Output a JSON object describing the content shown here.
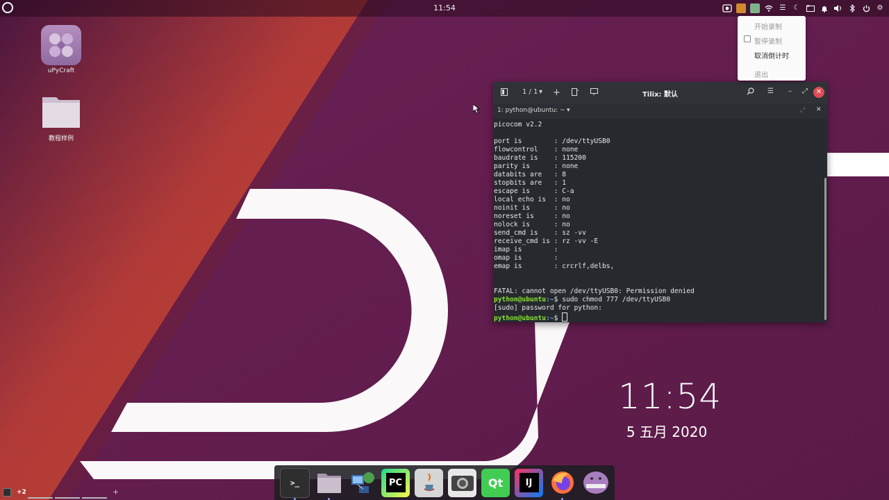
{
  "topbar": {
    "clock": "11:54",
    "tray": [
      "screen-record-icon",
      "app-icon-orange",
      "app-icon-green",
      "wifi-icon",
      "menu-icon",
      "night-mode-icon",
      "folder-icon",
      "notification-icon",
      "volume-icon",
      "bluetooth-icon",
      "power-icon",
      "settings-icon"
    ]
  },
  "menu": {
    "items": [
      {
        "label": "开始录制",
        "enabled": false
      },
      {
        "label": "暂停录制",
        "enabled": false,
        "checkbox": true
      },
      {
        "label": "取消倒计时",
        "enabled": true
      },
      {
        "label": "退出",
        "enabled": false
      }
    ]
  },
  "desktop": {
    "icons": [
      {
        "label": "uPyCraft",
        "icon": "upycraft-icon"
      },
      {
        "label": "教程样例",
        "icon": "folder-icon"
      }
    ],
    "clock": {
      "time": "11:54",
      "date": "5 五月 2020"
    }
  },
  "terminal": {
    "tab_counter": "1 / 1",
    "title": "Tilix: 默认",
    "session_label": "1: python@ubuntu: ~",
    "lines": [
      "picocom v2.2",
      "",
      "port is        : /dev/ttyUSB0",
      "flowcontrol    : none",
      "baudrate is    : 115200",
      "parity is      : none",
      "databits are   : 8",
      "stopbits are   : 1",
      "escape is      : C-a",
      "local echo is  : no",
      "noinit is      : no",
      "noreset is     : no",
      "nolock is      : no",
      "send_cmd is    : sz -vv",
      "receive_cmd is : rz -vv -E",
      "imap is        :",
      "omap is        :",
      "emap is        : crcrlf,delbs,",
      "",
      "",
      "FATAL: cannot open /dev/ttyUSB0: Permission denied"
    ],
    "prompt_user": "python@ubuntu",
    "prompt_path": ":~",
    "prompt_symbol": "$",
    "cmd1": " sudo chmod 777 /dev/ttyUSB0",
    "sudo_line": "[sudo] password for python:",
    "cmd2": " "
  },
  "dock": {
    "apps": [
      "terminal-icon",
      "files-icon",
      "network-icon",
      "pycharm-icon",
      "java-icon",
      "camera-icon",
      "qt-creator-icon",
      "intellij-icon",
      "firefox-icon",
      "ghost-app-icon"
    ],
    "labels": {
      "terminal": ">_",
      "pycharm": "PC",
      "qt": "Qt",
      "intellij": "IJ"
    }
  },
  "workspace": {
    "count_label": "+2",
    "add_label": "+"
  },
  "colors": {
    "accent": "#e04c55",
    "prompt_green": "#8ae234",
    "prompt_blue": "#729fcf",
    "wallpaper_purple": "#5a1c48"
  }
}
